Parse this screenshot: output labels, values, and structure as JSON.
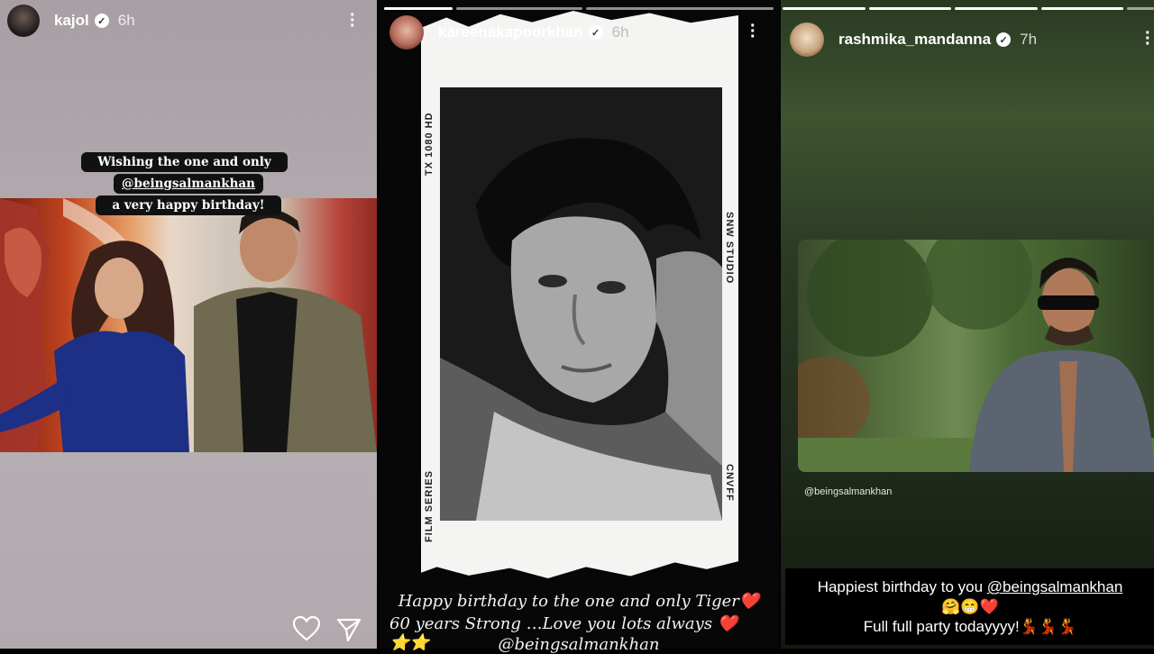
{
  "stories": [
    {
      "username": "kajol",
      "time": "6h",
      "caption_line1_prefix": "Wishing the one and only ",
      "caption_mention": "@beingsalmankhan",
      "caption_line2": "a very happy birthday!"
    },
    {
      "username": "kareenakapoorkhan",
      "time": "6h",
      "film_labels": {
        "left_top": "TX 1080 HD",
        "left_bottom": "FILM SERIES",
        "right_top": "SNW STUDIO",
        "right_bottom": "CNVFF"
      },
      "caption_line1": "Happy birthday to the one and only Tiger❤️",
      "caption_line2": "60 years Strong …Love you lots always ❤️⭐⭐",
      "caption_line3": "@beingsalmankhan"
    },
    {
      "username": "rashmika_mandanna",
      "time": "7h",
      "photo_mention": "@beingsalmankhan",
      "caption_line1_prefix": "Happiest birthday to you ",
      "caption_mention": "@beingsalmankhan",
      "caption_line2": "🤗😁❤️",
      "caption_line3": "Full full party todayyyy!💃💃💃"
    }
  ],
  "colors": {
    "verified_badge": "#ffffff",
    "sticker_bg": "#111111",
    "heart_icon": "#ffffff"
  },
  "icons": [
    "more-options-icon",
    "verified-icon",
    "heart-icon",
    "share-icon"
  ]
}
